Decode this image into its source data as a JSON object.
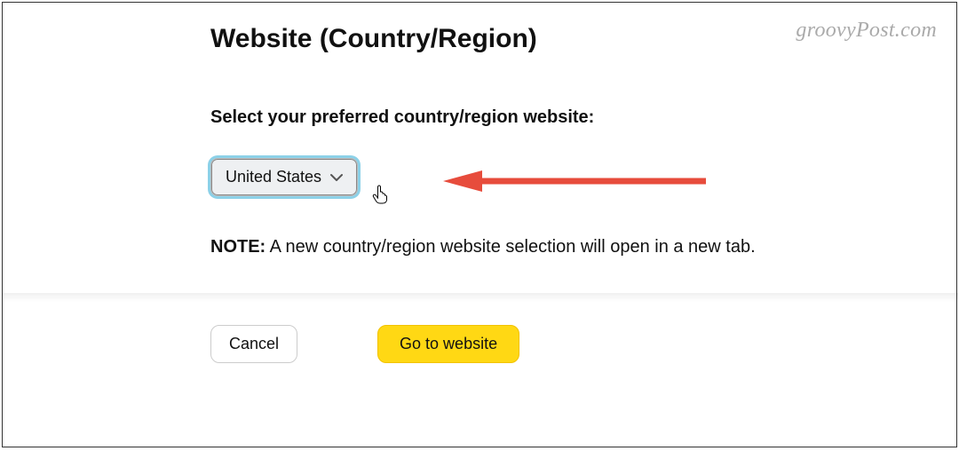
{
  "watermark": "groovyPost.com",
  "heading": "Website (Country/Region)",
  "label": "Select your preferred country/region website:",
  "dropdown": {
    "selected": "United States"
  },
  "note": {
    "prefix": "NOTE:",
    "text": " A new country/region website selection will open in a new tab."
  },
  "actions": {
    "cancel": "Cancel",
    "go": "Go to website"
  },
  "annotation": {
    "arrow_color": "#e74c3c"
  }
}
